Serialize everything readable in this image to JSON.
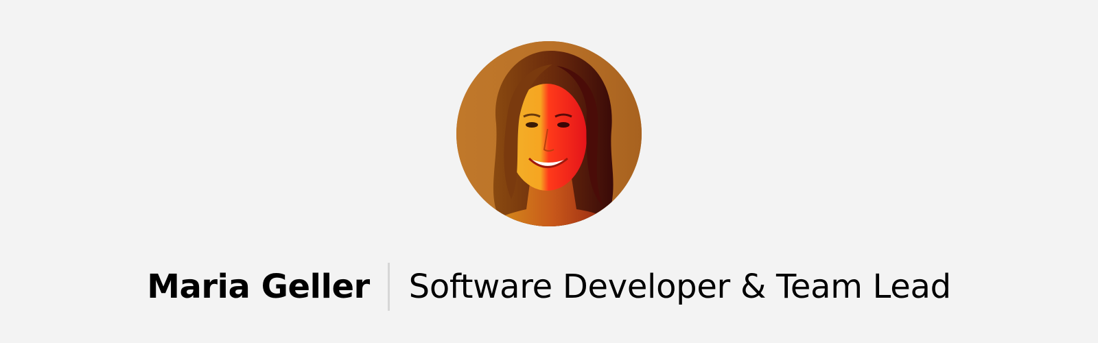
{
  "profile": {
    "name": "Maria Geller",
    "role": "Software Developer & Team Lead"
  },
  "colors": {
    "background": "#f3f3f3",
    "avatar_background": "#b8742a",
    "text": "#000000",
    "divider": "#d6d6d6"
  }
}
